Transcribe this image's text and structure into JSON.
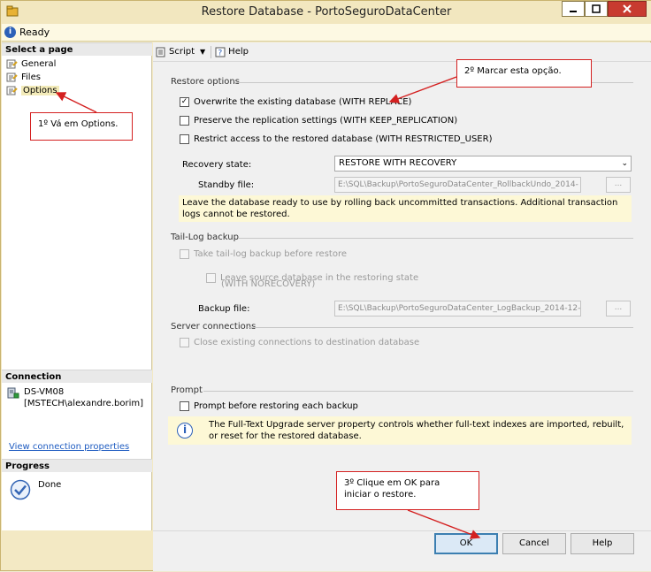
{
  "window": {
    "title": "Restore Database - PortoSeguroDataCenter"
  },
  "status": {
    "text": "Ready"
  },
  "left_pane": {
    "select_page_header": "Select a page",
    "pages": [
      {
        "label": "General"
      },
      {
        "label": "Files"
      },
      {
        "label": "Options"
      }
    ],
    "connection_header": "Connection",
    "server": "DS-VM08",
    "user": "[MSTECH\\alexandre.borim]",
    "view_connection_link": "View connection properties",
    "progress_header": "Progress",
    "progress_status": "Done"
  },
  "toolbar": {
    "script_label": "Script",
    "help_label": "Help"
  },
  "restore_options": {
    "title": "Restore options",
    "overwrite": {
      "label": "Overwrite the existing database (WITH REPLACE)",
      "checked": true
    },
    "preserve": {
      "label": "Preserve the replication settings (WITH KEEP_REPLICATION)",
      "checked": false
    },
    "restrict": {
      "label": "Restrict access to the restored database (WITH RESTRICTED_USER)",
      "checked": false
    },
    "recovery_state_label": "Recovery state:",
    "recovery_state_value": "RESTORE WITH RECOVERY",
    "standby_file_label": "Standby file:",
    "standby_file_value": "E:\\SQL\\Backup\\PortoSeguroDataCenter_RollbackUndo_2014-",
    "browse_label": "...",
    "recovery_note": "Leave the database ready to use by rolling back uncommitted transactions. Additional transaction logs cannot be restored."
  },
  "tail_log": {
    "title": "Tail-Log backup",
    "take_backup_label": "Take tail-log backup before restore",
    "leave_source_label": "Leave source database in the restoring state",
    "leave_source_sub": "(WITH NORECOVERY)",
    "backup_file_label": "Backup file:",
    "backup_file_value": "E:\\SQL\\Backup\\PortoSeguroDataCenter_LogBackup_2014-12-",
    "browse_label": "..."
  },
  "server_connections": {
    "title": "Server connections",
    "close_connections_label": "Close existing connections to destination database"
  },
  "prompt": {
    "title": "Prompt",
    "prompt_label": "Prompt before restoring each backup",
    "info_text": "The Full-Text Upgrade server property controls whether full-text indexes are imported, rebuilt, or reset for the restored database."
  },
  "buttons": {
    "ok": "OK",
    "cancel": "Cancel",
    "help": "Help"
  },
  "callouts": {
    "step1": "1º Vá em Options.",
    "step2": "2º Marcar esta opção.",
    "step3_line1": "3º Clique em OK para",
    "step3_line2": "iniciar o restore."
  },
  "colors": {
    "callout_border": "#d42020",
    "title_bar": "#f2e7bf",
    "close_button": "#c83b30"
  },
  "icons": {
    "status": "info-icon",
    "progress": "checkmark-icon",
    "server": "server-icon"
  }
}
